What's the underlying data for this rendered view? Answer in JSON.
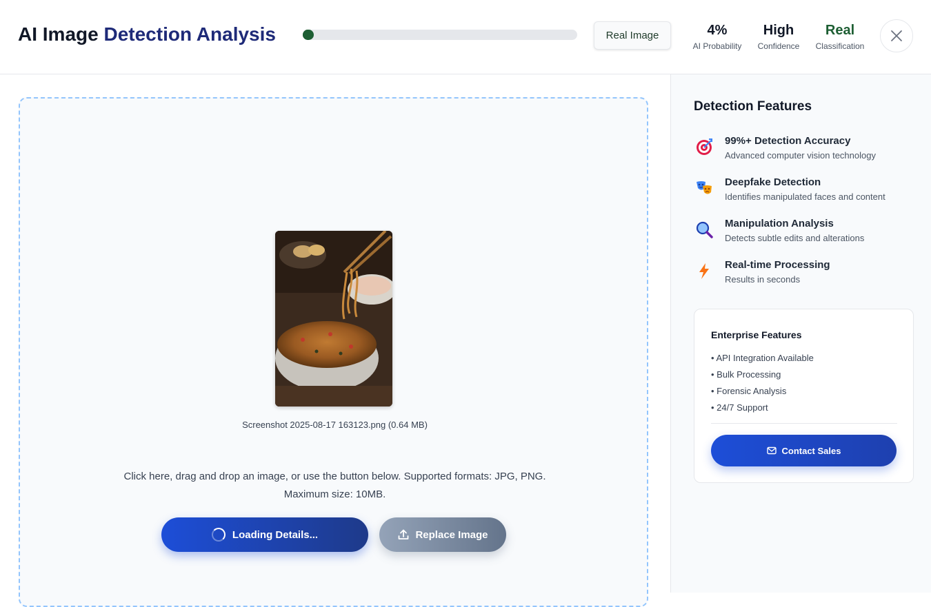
{
  "header": {
    "title_part1": "AI Image ",
    "title_part2": "Detection Analysis",
    "ai_probability_fraction": 0.04,
    "result_chip": "Real Image",
    "stats": [
      {
        "value": "4%",
        "label": "AI Probability"
      },
      {
        "value": "High",
        "label": "Confidence"
      },
      {
        "value": "Real",
        "label": "Classification"
      }
    ],
    "close_icon": "close-icon"
  },
  "upload": {
    "file_name": "Screenshot 2025-08-17 163123.png (0.64 MB)",
    "hint_line1": "Click here, drag and drop an image, or use the button below. Supported formats: JPG, PNG.",
    "hint_line2": "Maximum size: 10MB.",
    "primary_button": "Loading Details...",
    "secondary_button": "Replace Image",
    "preview_subject": "noodle bowl with chopsticks"
  },
  "sidebar": {
    "title": "Detection Features",
    "features": [
      {
        "icon": "target-icon",
        "title": "99%+ Detection Accuracy",
        "desc": "Advanced computer vision technology"
      },
      {
        "icon": "masks-icon",
        "title": "Deepfake Detection",
        "desc": "Identifies manipulated faces and content"
      },
      {
        "icon": "magnifier-icon",
        "title": "Manipulation Analysis",
        "desc": "Detects subtle edits and alterations"
      },
      {
        "icon": "lightning-icon",
        "title": "Real-time Processing",
        "desc": "Results in seconds"
      }
    ],
    "enterprise": {
      "title": "Enterprise Features",
      "items": [
        "• API Integration Available",
        "• Bulk Processing",
        "• Forensic Analysis",
        "• 24/7 Support"
      ],
      "button": "Contact Sales"
    }
  },
  "colors": {
    "accent_blue": "#1d4ed8",
    "real_green": "#1d5e33",
    "dropzone_border": "#93c5fd"
  }
}
